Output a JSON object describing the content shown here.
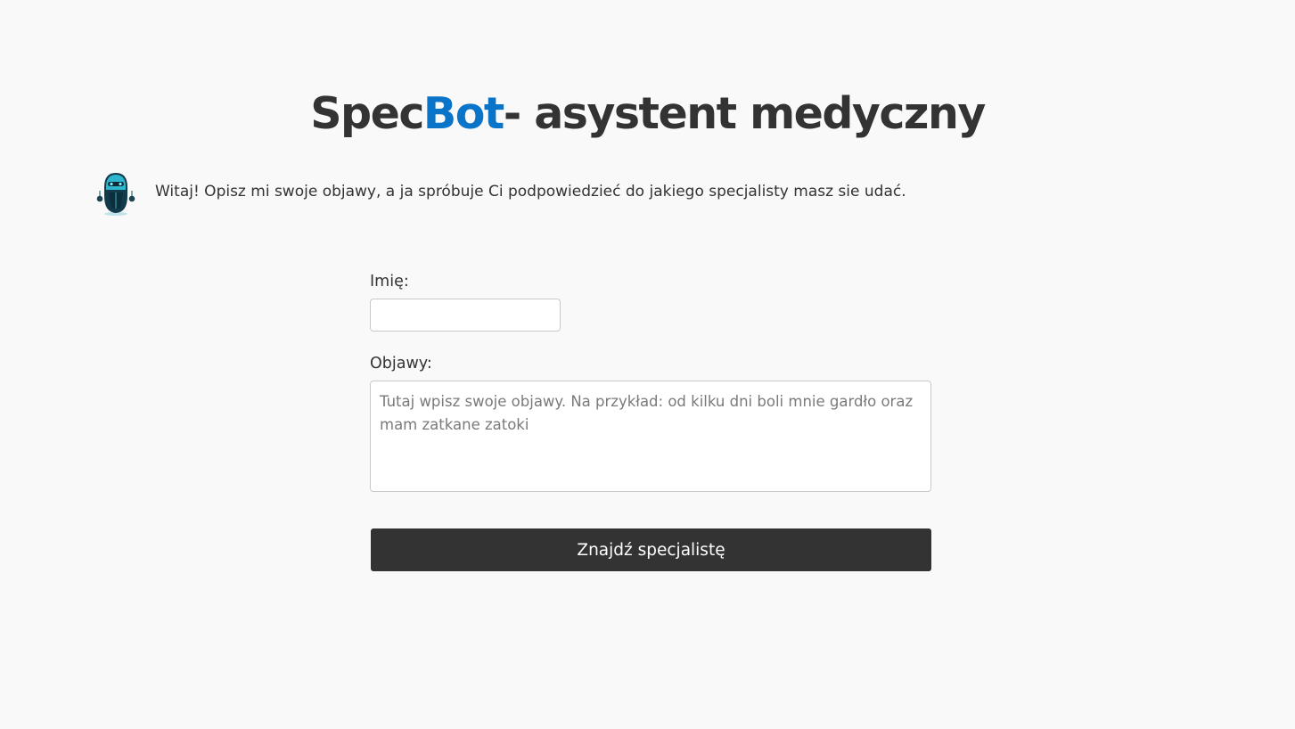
{
  "header": {
    "title_part1": "Spec",
    "title_accent": "Bot",
    "title_part2": "- asystent medyczny",
    "accent_color": "#0a74c9"
  },
  "greeting": {
    "avatar_icon": "robot-icon",
    "text": "Witaj! Opisz mi swoje objawy, a ja spróbuje Ci podpowiedzieć do jakiego specjalisty masz sie udać."
  },
  "form": {
    "name_label": "Imię:",
    "name_value": "",
    "symptoms_label": "Objawy:",
    "symptoms_placeholder": "Tutaj wpisz swoje objawy. Na przykład: od kilku dni boli mnie gardło oraz mam zatkane zatoki",
    "submit_label": "Znajdź specjalistę"
  }
}
